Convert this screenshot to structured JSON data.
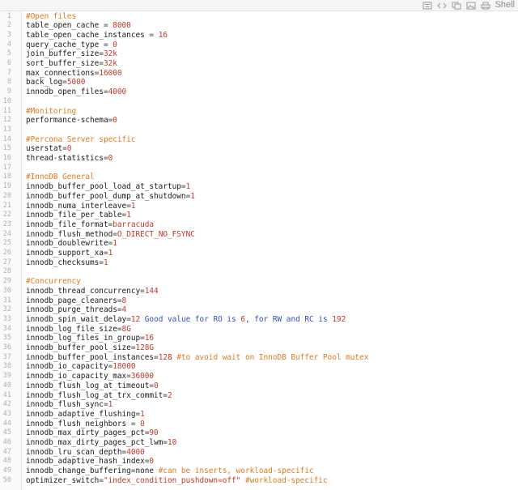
{
  "toolbar": {
    "icons": [
      "list-view-icon",
      "code-view-icon",
      "copy-icon",
      "image-icon",
      "print-icon"
    ],
    "shell_label": "Shell"
  },
  "colors": {
    "key": "#1a1a1a",
    "value": "#c0392b",
    "comment": "#e07a1f",
    "line_number": "#b0b0b0"
  },
  "lines": [
    [
      {
        "t": "#Open files",
        "c": "c"
      }
    ],
    [
      {
        "t": "table_open_cache",
        "c": "k"
      },
      {
        "t": " = ",
        "c": "eq"
      },
      {
        "t": "8000",
        "c": "v"
      }
    ],
    [
      {
        "t": "table_open_cache_instances",
        "c": "k"
      },
      {
        "t": " = ",
        "c": "eq"
      },
      {
        "t": "16",
        "c": "v"
      }
    ],
    [
      {
        "t": "query_cache_type",
        "c": "k"
      },
      {
        "t": " = ",
        "c": "eq"
      },
      {
        "t": "0",
        "c": "v"
      }
    ],
    [
      {
        "t": "join_buffer_size",
        "c": "k"
      },
      {
        "t": "=",
        "c": "eq"
      },
      {
        "t": "32k",
        "c": "v"
      }
    ],
    [
      {
        "t": "sort_buffer_size",
        "c": "k"
      },
      {
        "t": "=",
        "c": "eq"
      },
      {
        "t": "32k",
        "c": "v"
      }
    ],
    [
      {
        "t": "max_connections",
        "c": "k"
      },
      {
        "t": "=",
        "c": "eq"
      },
      {
        "t": "16000",
        "c": "v"
      }
    ],
    [
      {
        "t": "back_log",
        "c": "k"
      },
      {
        "t": "=",
        "c": "eq"
      },
      {
        "t": "5000",
        "c": "v"
      }
    ],
    [
      {
        "t": "innodb_open_files",
        "c": "k"
      },
      {
        "t": "=",
        "c": "eq"
      },
      {
        "t": "4000",
        "c": "v"
      }
    ],
    [],
    [
      {
        "t": "#Monitoring",
        "c": "c"
      }
    ],
    [
      {
        "t": "performance-schema",
        "c": "k"
      },
      {
        "t": "=",
        "c": "eq"
      },
      {
        "t": "0",
        "c": "v"
      }
    ],
    [],
    [
      {
        "t": "#Percona Server specific",
        "c": "c"
      }
    ],
    [
      {
        "t": "userstat",
        "c": "k"
      },
      {
        "t": "=",
        "c": "eq"
      },
      {
        "t": "0",
        "c": "v"
      }
    ],
    [
      {
        "t": "thread-statistics",
        "c": "k"
      },
      {
        "t": "=",
        "c": "eq"
      },
      {
        "t": "0",
        "c": "v"
      }
    ],
    [],
    [
      {
        "t": "#InnoDB General",
        "c": "c"
      }
    ],
    [
      {
        "t": "innodb_buffer_pool_load_at_startup",
        "c": "k"
      },
      {
        "t": "=",
        "c": "eq"
      },
      {
        "t": "1",
        "c": "v"
      }
    ],
    [
      {
        "t": "innodb_buffer_pool_dump_at_shutdown",
        "c": "k"
      },
      {
        "t": "=",
        "c": "eq"
      },
      {
        "t": "1",
        "c": "v"
      }
    ],
    [
      {
        "t": "innodb_numa_interleave",
        "c": "k"
      },
      {
        "t": "=",
        "c": "eq"
      },
      {
        "t": "1",
        "c": "v"
      }
    ],
    [
      {
        "t": "innodb_file_per_table",
        "c": "k"
      },
      {
        "t": "=",
        "c": "eq"
      },
      {
        "t": "1",
        "c": "v"
      }
    ],
    [
      {
        "t": "innodb_file_format",
        "c": "k"
      },
      {
        "t": "=",
        "c": "eq"
      },
      {
        "t": "barracuda",
        "c": "v"
      }
    ],
    [
      {
        "t": "innodb_flush_method",
        "c": "k"
      },
      {
        "t": "=",
        "c": "eq"
      },
      {
        "t": "O_DIRECT_NO_FSYNC",
        "c": "v"
      }
    ],
    [
      {
        "t": "innodb_doublewrite",
        "c": "k"
      },
      {
        "t": "=",
        "c": "eq"
      },
      {
        "t": "1",
        "c": "v"
      }
    ],
    [
      {
        "t": "innodb_support_xa",
        "c": "k"
      },
      {
        "t": "=",
        "c": "eq"
      },
      {
        "t": "1",
        "c": "v"
      }
    ],
    [
      {
        "t": "innodb_checksums",
        "c": "k"
      },
      {
        "t": "=",
        "c": "eq"
      },
      {
        "t": "1",
        "c": "v"
      }
    ],
    [],
    [
      {
        "t": "#Concurrency",
        "c": "c"
      }
    ],
    [
      {
        "t": "innodb_thread_concurrency",
        "c": "k"
      },
      {
        "t": "=",
        "c": "eq"
      },
      {
        "t": "144",
        "c": "v"
      }
    ],
    [
      {
        "t": "innodb_page_cleaners",
        "c": "k"
      },
      {
        "t": "=",
        "c": "eq"
      },
      {
        "t": "8",
        "c": "v"
      }
    ],
    [
      {
        "t": "innodb_purge_threads",
        "c": "k"
      },
      {
        "t": "=",
        "c": "eq"
      },
      {
        "t": "4",
        "c": "v"
      }
    ],
    [
      {
        "t": "innodb_spin_wait_delay",
        "c": "k"
      },
      {
        "t": "=",
        "c": "eq"
      },
      {
        "t": "12",
        "c": "v"
      },
      {
        "t": " Good value for ",
        "c": "n"
      },
      {
        "t": "RO",
        "c": "n"
      },
      {
        "t": " is ",
        "c": "n"
      },
      {
        "t": "6",
        "c": "v"
      },
      {
        "t": ", for ",
        "c": "n"
      },
      {
        "t": "RW",
        "c": "n"
      },
      {
        "t": " and ",
        "c": "n"
      },
      {
        "t": "RC",
        "c": "n"
      },
      {
        "t": " is ",
        "c": "n"
      },
      {
        "t": "192",
        "c": "v"
      }
    ],
    [
      {
        "t": "innodb_log_file_size",
        "c": "k"
      },
      {
        "t": "=",
        "c": "eq"
      },
      {
        "t": "8G",
        "c": "v"
      }
    ],
    [
      {
        "t": "innodb_log_files_in_group",
        "c": "k"
      },
      {
        "t": "=",
        "c": "eq"
      },
      {
        "t": "16",
        "c": "v"
      }
    ],
    [
      {
        "t": "innodb_buffer_pool_size",
        "c": "k"
      },
      {
        "t": "=",
        "c": "eq"
      },
      {
        "t": "128G",
        "c": "v"
      }
    ],
    [
      {
        "t": "innodb_buffer_pool_instances",
        "c": "k"
      },
      {
        "t": "=",
        "c": "eq"
      },
      {
        "t": "128",
        "c": "v"
      },
      {
        "t": " #to avoid wait on InnoDB Buffer Pool mutex",
        "c": "c"
      }
    ],
    [
      {
        "t": "innodb_io_capacity",
        "c": "k"
      },
      {
        "t": "=",
        "c": "eq"
      },
      {
        "t": "18000",
        "c": "v"
      }
    ],
    [
      {
        "t": "innodb_io_capacity_max",
        "c": "k"
      },
      {
        "t": "=",
        "c": "eq"
      },
      {
        "t": "36000",
        "c": "v"
      }
    ],
    [
      {
        "t": "innodb_flush_log_at_timeout",
        "c": "k"
      },
      {
        "t": "=",
        "c": "eq"
      },
      {
        "t": "0",
        "c": "v"
      }
    ],
    [
      {
        "t": "innodb_flush_log_at_trx_commit",
        "c": "k"
      },
      {
        "t": "=",
        "c": "eq"
      },
      {
        "t": "2",
        "c": "v"
      }
    ],
    [
      {
        "t": "innodb_flush_sync",
        "c": "k"
      },
      {
        "t": "=",
        "c": "eq"
      },
      {
        "t": "1",
        "c": "v"
      }
    ],
    [
      {
        "t": "innodb_adaptive_flushing",
        "c": "k"
      },
      {
        "t": "=",
        "c": "eq"
      },
      {
        "t": "1",
        "c": "v"
      }
    ],
    [
      {
        "t": "innodb_flush_neighbors",
        "c": "k"
      },
      {
        "t": " = ",
        "c": "eq"
      },
      {
        "t": "0",
        "c": "v"
      }
    ],
    [
      {
        "t": "innodb_max_dirty_pages_pct",
        "c": "k"
      },
      {
        "t": "=",
        "c": "eq"
      },
      {
        "t": "90",
        "c": "v"
      }
    ],
    [
      {
        "t": "innodb_max_dirty_pages_pct_lwm",
        "c": "k"
      },
      {
        "t": "=",
        "c": "eq"
      },
      {
        "t": "10",
        "c": "v"
      }
    ],
    [
      {
        "t": "innodb_lru_scan_depth",
        "c": "k"
      },
      {
        "t": "=",
        "c": "eq"
      },
      {
        "t": "4000",
        "c": "v"
      }
    ],
    [
      {
        "t": "innodb_adaptive_hash_index",
        "c": "k"
      },
      {
        "t": "=",
        "c": "eq"
      },
      {
        "t": "0",
        "c": "v"
      }
    ],
    [
      {
        "t": "innodb_change_buffering",
        "c": "k"
      },
      {
        "t": "=",
        "c": "eq"
      },
      {
        "t": "none",
        "c": "k"
      },
      {
        "t": " #can be inserts, workload-specific",
        "c": "c"
      }
    ],
    [
      {
        "t": "optimizer_switch",
        "c": "k"
      },
      {
        "t": "=",
        "c": "eq"
      },
      {
        "t": "\"index_condition_pushdown=off\"",
        "c": "s"
      },
      {
        "t": " #workload-specific",
        "c": "c"
      }
    ]
  ]
}
